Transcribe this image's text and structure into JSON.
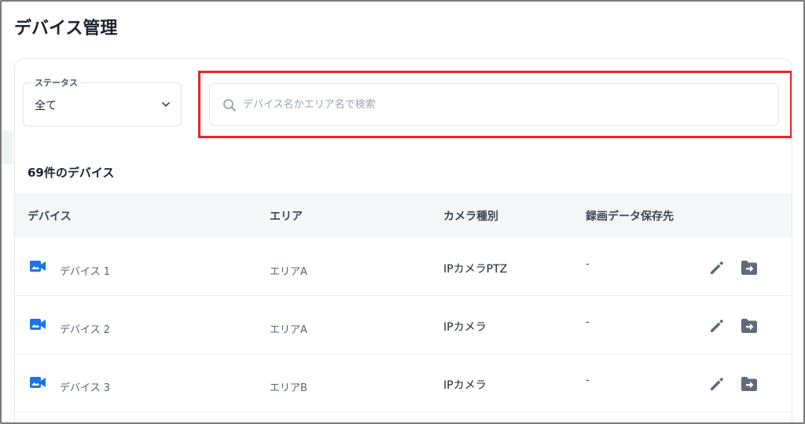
{
  "page": {
    "title": "デバイス管理"
  },
  "filters": {
    "status_label": "ステータス",
    "status_value": "全て",
    "search_placeholder": "デバイス名かエリア名で検索",
    "search_value": ""
  },
  "summary": {
    "count_text": "69件のデバイス"
  },
  "table": {
    "columns": [
      "デバイス",
      "エリア",
      "カメラ種別",
      "録画データ保存先"
    ],
    "rows": [
      {
        "device": "デバイス 1",
        "area": "エリアA",
        "camera_type": "IPカメラPTZ",
        "destination": "-"
      },
      {
        "device": "デバイス 2",
        "area": "エリアA",
        "camera_type": "IPカメラ",
        "destination": "-"
      },
      {
        "device": "デバイス 3",
        "area": "エリアB",
        "camera_type": "IPカメラ",
        "destination": "-"
      }
    ]
  },
  "icons": {
    "device": "videocam-icon",
    "edit": "pencil-icon",
    "move": "folder-move-icon",
    "search": "search-icon",
    "dropdown": "chevron-down-icon"
  },
  "colors": {
    "accent_blue": "#1a73e8",
    "highlight_red": "#e8262a",
    "icon_gray": "#5f6b7a",
    "header_bg": "#f4f6f8"
  }
}
